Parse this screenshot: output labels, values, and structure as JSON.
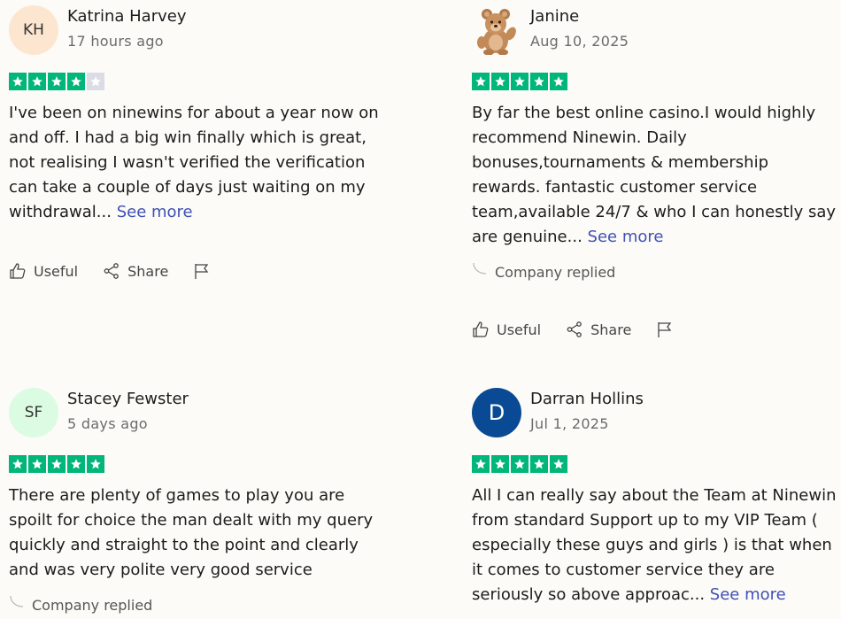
{
  "reviews": [
    {
      "initials": "KH",
      "name": "Katrina Harvey",
      "date": "17 hours ago",
      "rating": 4,
      "text": "I've been on ninewins for about a year now on and off. I had a big win finally which is great, not realising I wasn't verified the verification can take a couple of days just waiting on my withdrawal... ",
      "see_more": "See more",
      "useful": "Useful",
      "share": "Share"
    },
    {
      "initials": "",
      "avatar_icon": "teddy-bear-icon",
      "name": "Janine",
      "date": "Aug 10, 2025",
      "rating": 5,
      "text": "By far the best online casino.I would highly recommend Ninewin. Daily bonuses,tournaments & membership rewards. fantastic customer service team,available 24/7 & who I can honestly say are genuine... ",
      "see_more": "See more",
      "company_replied": "Company replied",
      "useful": "Useful",
      "share": "Share"
    },
    {
      "initials": "SF",
      "name": "Stacey Fewster",
      "date": "5 days ago",
      "rating": 5,
      "text": "There are plenty of games to play you are spoilt for choice the man dealt with my query quickly and straight to the point and clearly and was very polite very good service",
      "company_replied": "Company replied"
    },
    {
      "initials": "D",
      "name": "Darran Hollins",
      "date": "Jul 1, 2025",
      "rating": 5,
      "text": "All I can really say about the Team at Ninewin from standard Support up to my VIP Team ( especially these guys and girls ) is that when it comes to customer service they are seriously so above approac... ",
      "see_more": "See more"
    }
  ],
  "colors": {
    "star_green": "#00b67a",
    "star_off": "#dcdce6",
    "link": "#3f51b5",
    "avatar_kh": "#fde6cf",
    "avatar_sf": "#dcfbe3",
    "avatar_d": "#0a4a95"
  }
}
